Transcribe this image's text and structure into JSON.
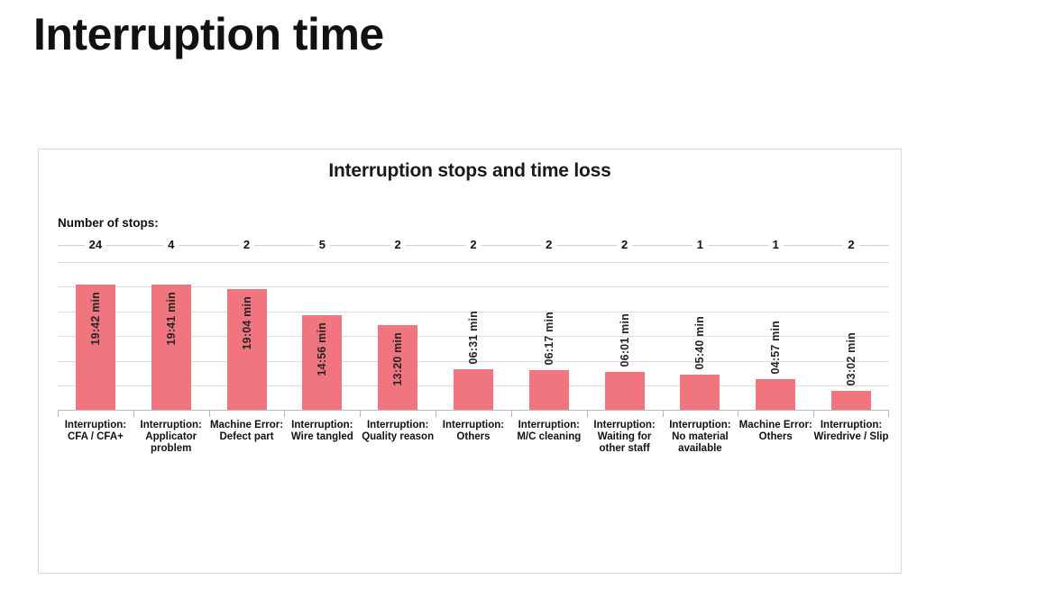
{
  "slide": {
    "title": "Interruption time"
  },
  "chart_panel": {
    "stops_label": "Number of stops:"
  },
  "chart_data": {
    "type": "bar",
    "title": "Interruption stops and time loss",
    "xlabel": "",
    "ylabel": "",
    "grid": true,
    "legend": false,
    "ylim": [
      0,
      1200
    ],
    "categories": [
      "Interruption: CFA / CFA+",
      "Interruption: Applicator problem",
      "Machine Error: Defect part",
      "Interruption: Wire tangled",
      "Interruption: Quality reason",
      "Interruption: Others",
      "Interruption: M/C cleaning",
      "Interruption: Waiting for other staff",
      "Interruption: No material available",
      "Machine Error: Others",
      "Interruption: Wiredrive / Slip"
    ],
    "category_lines": [
      [
        "Interruption:",
        "CFA / CFA+"
      ],
      [
        "Interruption:",
        "Applicator",
        "problem"
      ],
      [
        "Machine Error:",
        "Defect part"
      ],
      [
        "Interruption:",
        "Wire tangled"
      ],
      [
        "Interruption:",
        "Quality reason"
      ],
      [
        "Interruption:",
        "Others"
      ],
      [
        "Interruption:",
        "M/C cleaning"
      ],
      [
        "Interruption:",
        "Waiting for",
        "other staff"
      ],
      [
        "Interruption:",
        "No material",
        "available"
      ],
      [
        "Machine Error:",
        "Others"
      ],
      [
        "Interruption:",
        "Wiredrive / Slip"
      ]
    ],
    "value_labels": [
      "19:42 min",
      "19:41 min",
      "19:04 min",
      "14:56 min",
      "13:20 min",
      "06:31 min",
      "06:17 min",
      "06:01 min",
      "05:40 min",
      "04:57 min",
      "03:02 min"
    ],
    "values_seconds": [
      1182,
      1181,
      1144,
      896,
      800,
      391,
      377,
      361,
      340,
      297,
      182
    ],
    "number_of_stops": [
      24,
      4,
      2,
      5,
      2,
      2,
      2,
      2,
      1,
      1,
      2
    ],
    "bar_color": "#f0757f"
  }
}
